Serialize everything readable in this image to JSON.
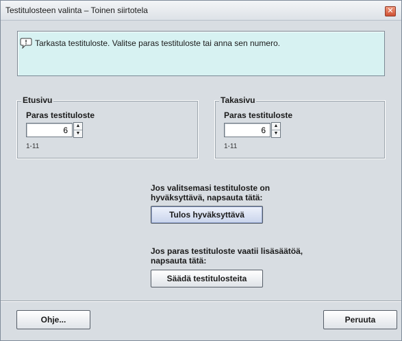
{
  "window": {
    "title": "Testitulosteen valinta – Toinen siirtotela",
    "close_icon": "close-icon"
  },
  "message": {
    "icon": "speech-bubble-icon",
    "text": "Tarkasta testituloste. Valitse paras testituloste tai anna sen numero."
  },
  "front": {
    "legend": "Etusivu",
    "field_label": "Paras testituloste",
    "value": "6",
    "range": "1-11"
  },
  "back": {
    "legend": "Takasivu",
    "field_label": "Paras testituloste",
    "value": "6",
    "range": "1-11"
  },
  "accept": {
    "prompt_line1": "Jos valitsemasi testituloste on",
    "prompt_line2": "hyväksyttävä, napsauta tätä:",
    "button_label": "Tulos hyväksyttävä"
  },
  "adjust": {
    "prompt_line1": "Jos paras testituloste vaatii lisäsäätöä,",
    "prompt_line2": "napsauta tätä:",
    "button_label": "Säädä testitulosteita"
  },
  "footer": {
    "help_label": "Ohje...",
    "cancel_label": "Peruuta"
  }
}
